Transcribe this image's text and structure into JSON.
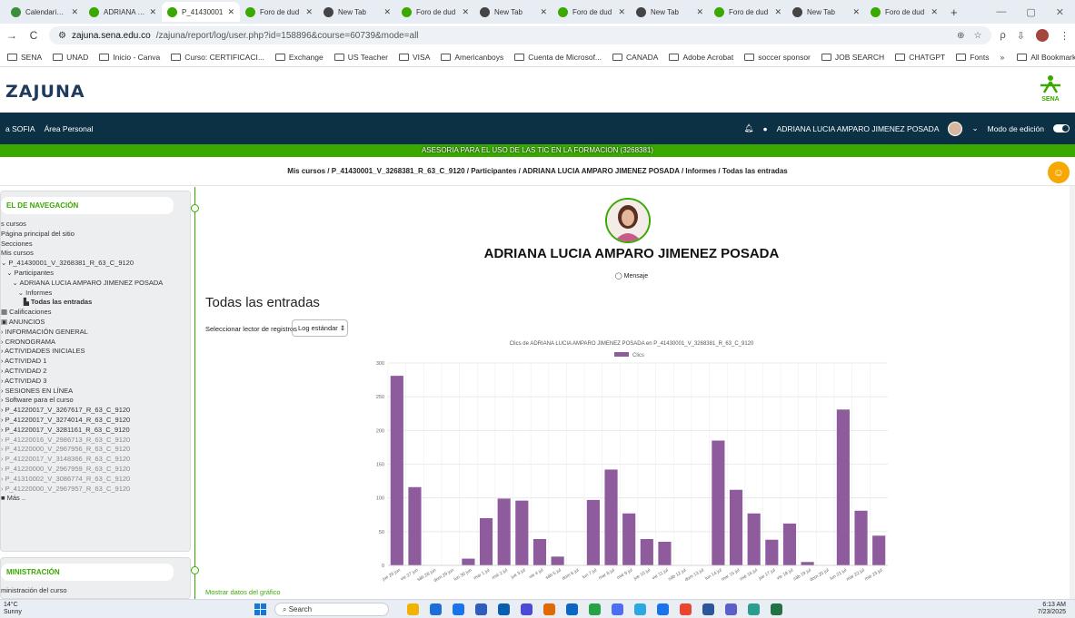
{
  "browser": {
    "tabs": [
      {
        "label": "Calendario C",
        "color": "#3a8f3a",
        "active": false
      },
      {
        "label": "ADRIANA LU",
        "color": "#39a900",
        "active": false
      },
      {
        "label": "P_41430001",
        "color": "#39a900",
        "active": true
      },
      {
        "label": "Foro de dud",
        "color": "#39a900",
        "active": false
      },
      {
        "label": "New Tab",
        "color": "#444444",
        "active": false
      },
      {
        "label": "Foro de dud",
        "color": "#39a900",
        "active": false
      },
      {
        "label": "New Tab",
        "color": "#444444",
        "active": false
      },
      {
        "label": "Foro de dud",
        "color": "#39a900",
        "active": false
      },
      {
        "label": "New Tab",
        "color": "#444444",
        "active": false
      },
      {
        "label": "Foro de dud",
        "color": "#39a900",
        "active": false
      },
      {
        "label": "New Tab",
        "color": "#444444",
        "active": false
      },
      {
        "label": "Foro de dud",
        "color": "#39a900",
        "active": false
      }
    ],
    "url_host": "zajuna.sena.edu.co",
    "url_path": "/zajuna/report/log/user.php?id=158896&course=60739&mode=all",
    "bookmarks": [
      "SENA",
      "UNAD",
      "Inicio - Canva",
      "Curso: CERTIFICACI...",
      "Exchange",
      "US Teacher",
      "VISA",
      "Americanboys",
      "Cuenta de Microsof...",
      "CANADA",
      "Adobe Acrobat",
      "soccer sponsor",
      "JOB SEARCH",
      "CHATGPT",
      "Fonts"
    ],
    "all_bookmarks": "All Bookmarks"
  },
  "site": {
    "logo": "ZAJUNA",
    "sena_logo": "SENA",
    "nav_links": [
      "a SOFIA",
      "Área Personal"
    ],
    "user_name": "ADRIANA LUCIA AMPARO JIMENEZ POSADA",
    "edit_mode": "Modo de edición",
    "course_title": "ASESORIA PARA EL USO DE LAS TIC EN LA FORMACION (3268381)",
    "breadcrumb": "Mis cursos / P_41430001_V_3268381_R_63_C_9120 / Participantes / ADRIANA LUCIA AMPARO JIMENEZ POSADA / Informes / Todas las entradas"
  },
  "sidebar": {
    "nav_title": "EL DE NAVEGACIÓN",
    "items": [
      {
        "label": "s cursos",
        "style": ""
      },
      {
        "label": "Página principal del sitio",
        "style": ""
      },
      {
        "label": "Secciones",
        "style": ""
      },
      {
        "label": "Mis cursos",
        "style": ""
      },
      {
        "label": "⌄ P_41430001_V_3268381_R_63_C_9120",
        "style": ""
      },
      {
        "label": "   ⌄ Participantes",
        "style": ""
      },
      {
        "label": "      ⌄ ADRIANA LUCIA AMPARO JIMENEZ POSADA",
        "style": ""
      },
      {
        "label": "         ⌄ Informes",
        "style": ""
      },
      {
        "label": "            ▙ Todas las entradas",
        "style": "bold"
      },
      {
        "label": "▦ Calificaciones",
        "style": ""
      },
      {
        "label": "▣ ANUNCIOS",
        "style": ""
      },
      {
        "label": "› INFORMACIÓN GENERAL",
        "style": ""
      },
      {
        "label": "› CRONOGRAMA",
        "style": ""
      },
      {
        "label": "› ACTIVIDADES INICIALES",
        "style": ""
      },
      {
        "label": "› ACTIVIDAD 1",
        "style": ""
      },
      {
        "label": "› ACTIVIDAD 2",
        "style": ""
      },
      {
        "label": "› ACTIVIDAD 3",
        "style": ""
      },
      {
        "label": "› SESIONES EN LÍNEA",
        "style": ""
      },
      {
        "label": "› Software para el curso",
        "style": ""
      },
      {
        "label": "› P_41220017_V_3267617_R_63_C_9120",
        "style": ""
      },
      {
        "label": "› P_41220017_V_3274014_R_63_C_9120",
        "style": ""
      },
      {
        "label": "› P_41220017_V_3281161_R_63_C_9120",
        "style": ""
      },
      {
        "label": "› P_41220016_V_2986713_R_63_C_9120",
        "style": "dim"
      },
      {
        "label": "› P_41220000_V_2967956_R_63_C_9120",
        "style": "dim"
      },
      {
        "label": "› P_41220017_V_3148366_R_63_C_9120",
        "style": "dim"
      },
      {
        "label": "› P_41220000_V_2967959_R_63_C_9120",
        "style": "dim"
      },
      {
        "label": "› P_41310002_V_3086774_R_63_C_9120",
        "style": "dim"
      },
      {
        "label": "› P_41220000_V_2967957_R_63_C_9120",
        "style": "dim"
      },
      {
        "label": "■ Más ..",
        "style": ""
      }
    ],
    "admin_title": "MINISTRACIÓN",
    "admin_item": "ministración del curso"
  },
  "main": {
    "profile_name": "ADRIANA LUCIA AMPARO JIMENEZ POSADA",
    "message": "Mensaje",
    "heading": "Todas las entradas",
    "log_label": "Seleccionar lector de registros",
    "log_select": "Log estándar",
    "show_data": "Mostrar datos del gráfico"
  },
  "chart_data": {
    "type": "bar",
    "title": "Clics de ADRIANA LUCIA AMPARO JIMENEZ POSADA  en P_41430001_V_3268381_R_63_C_9120",
    "legend": "Clics",
    "legend_position": "top",
    "bar_color": "#8e5b9c",
    "ylim": [
      0,
      300
    ],
    "yticks": [
      0,
      50,
      100,
      150,
      200,
      250,
      300
    ],
    "grid": true,
    "categories": [
      "jue 26 jun",
      "vie 27 jun",
      "sáb 28 jun",
      "dom 29 jun",
      "lun 30 jun",
      "mar 1 jul",
      "mié 2 jul",
      "jue 3 jul",
      "vie 4 jul",
      "sáb 5 jul",
      "dom 6 jul",
      "lun 7 jul",
      "mar 8 jul",
      "mié 9 jul",
      "jue 10 jul",
      "vie 11 jul",
      "sáb 12 jul",
      "dom 13 jul",
      "lun 14 jul",
      "mar 15 jul",
      "mié 16 jul",
      "jue 17 jul",
      "vie 18 jul",
      "sáb 19 jul",
      "dom 20 jul",
      "lun 21 jul",
      "mar 22 jul",
      "mié 23 jul"
    ],
    "values": [
      281,
      116,
      0,
      0,
      10,
      70,
      99,
      96,
      39,
      13,
      0,
      97,
      142,
      77,
      39,
      35,
      0,
      0,
      185,
      112,
      77,
      38,
      62,
      5,
      0,
      231,
      81,
      44
    ]
  },
  "taskbar": {
    "temp": "14°C",
    "weather": "Sunny",
    "search": "Search",
    "time": "6:13 AM",
    "date": "7/23/2025",
    "icons": [
      "#f2b200",
      "#1d6fd8",
      "#1a73e8",
      "#2f5dbd",
      "#0a5eb0",
      "#4a4ad6",
      "#e06a00",
      "#0a66c2",
      "#27a244",
      "#4e6ef2",
      "#2ca7e0",
      "#1a73e8",
      "#e8462e",
      "#2b579a",
      "#5b5fc7",
      "#2a9d8f",
      "#217346"
    ]
  }
}
